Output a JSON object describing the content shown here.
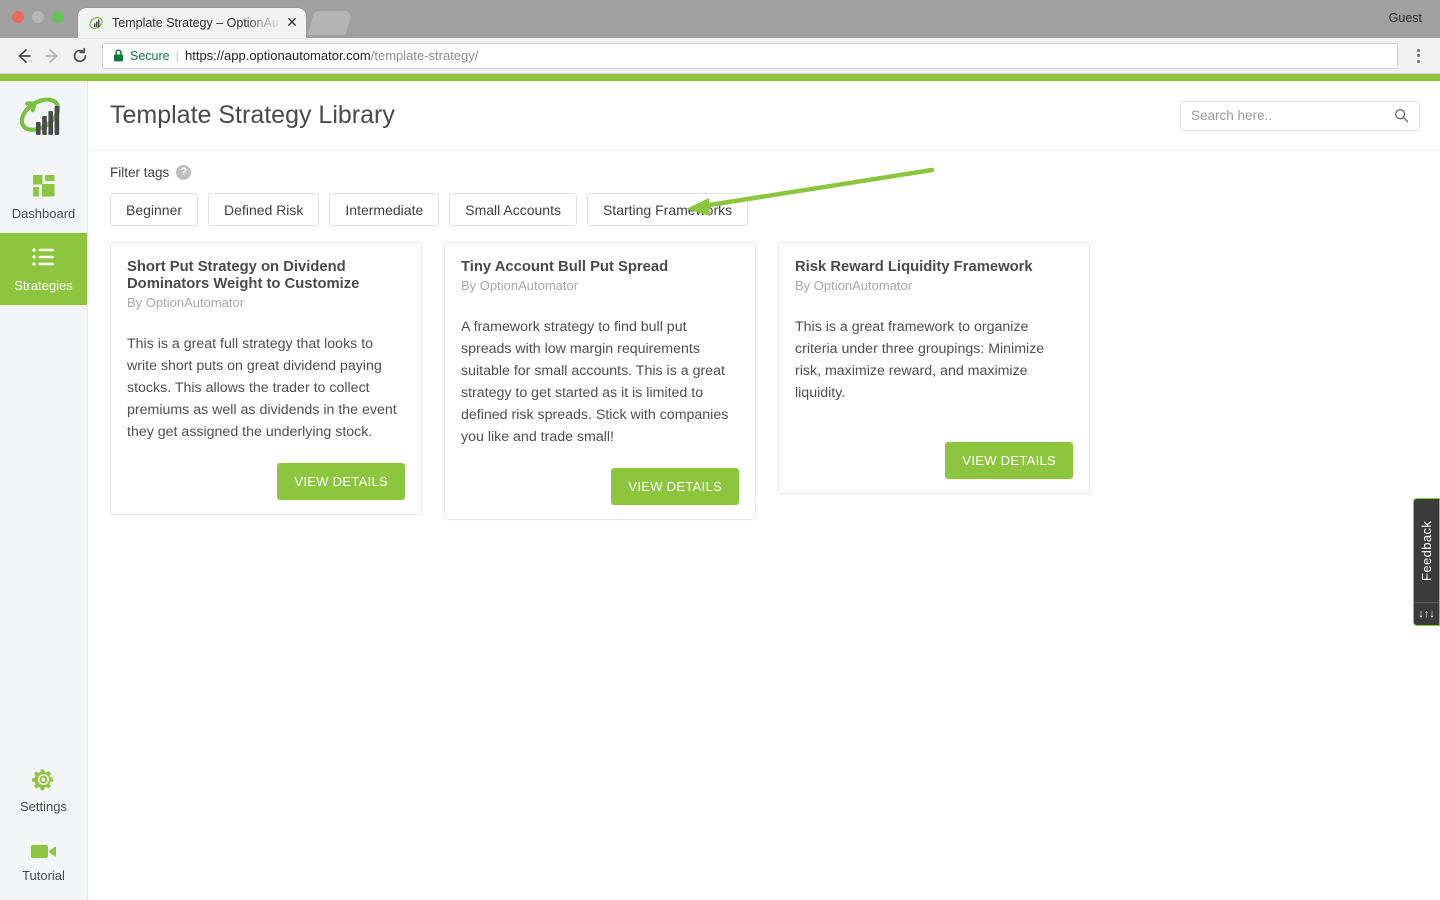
{
  "browser": {
    "tab": {
      "title": "Template Strategy – OptionAutomator",
      "favicon_icon": "optionautomator-logo-icon",
      "close_icon": "close-icon",
      "new_tab_icon": "new-tab-icon"
    },
    "profile_label": "Guest",
    "toolbar": {
      "back_icon": "back-arrow-icon",
      "forward_icon": "forward-arrow-icon",
      "reload_icon": "reload-icon",
      "lock_icon": "lock-icon",
      "secure_label": "Secure",
      "separator": "|",
      "url_domain": "https://app.optionautomator.com",
      "url_path": "/template-strategy/",
      "menu_icon": "kebab-menu-icon"
    }
  },
  "sidebar": {
    "logo_icon": "optionautomator-logo-icon",
    "items": [
      {
        "label": "Dashboard",
        "icon": "grid-dashboard-icon",
        "active": false
      },
      {
        "label": "Strategies",
        "icon": "list-lines-icon",
        "active": true
      }
    ],
    "bottom_items": [
      {
        "label": "Settings",
        "icon": "gear-icon"
      },
      {
        "label": "Tutorial",
        "icon": "video-camera-icon"
      }
    ]
  },
  "header": {
    "title": "Template Strategy Library",
    "search": {
      "placeholder": "Search here..",
      "value": "",
      "icon": "search-icon"
    }
  },
  "filters": {
    "label": "Filter tags",
    "help_icon": "question-mark-icon",
    "help_glyph": "?",
    "tags": [
      "Beginner",
      "Defined Risk",
      "Intermediate",
      "Small Accounts",
      "Starting Frameworks"
    ]
  },
  "cards": [
    {
      "title": "Short Put Strategy on Dividend Dominators Weight to Customize",
      "author": "By OptionAutomator",
      "description": "This is a great full strategy that looks to write short puts on great dividend paying stocks. This allows the trader to collect premiums as well as dividends in the event they get assigned the underlying stock.",
      "button": "VIEW DETAILS"
    },
    {
      "title": "Tiny Account Bull Put Spread",
      "author": "By OptionAutomator",
      "description": "A framework strategy to find bull put spreads with low margin requirements suitable for small accounts. This is a great strategy to get started as it is limited to defined risk spreads. Stick with companies you like and trade small!",
      "button": "VIEW DETAILS"
    },
    {
      "title": "Risk Reward Liquidity Framework",
      "author": "By OptionAutomator",
      "description": "This is a great framework to organize criteria under three groupings: Minimize risk, maximize reward, and maximize liquidity.",
      "button": "VIEW DETAILS"
    }
  ],
  "feedback": {
    "label": "Feedback",
    "handle_icon": "resize-arrows-icon",
    "handle_glyph": "↓↑↓"
  },
  "annotation": {
    "type": "arrow",
    "color": "#8cc63e",
    "points_to": "Starting Frameworks"
  },
  "colors": {
    "brand_green": "#8cc63e",
    "sidebar_bg": "#f4f5f6",
    "secure_green": "#0c7a3e",
    "text_dark": "#4a4a4a",
    "muted": "#a8a8a8"
  }
}
